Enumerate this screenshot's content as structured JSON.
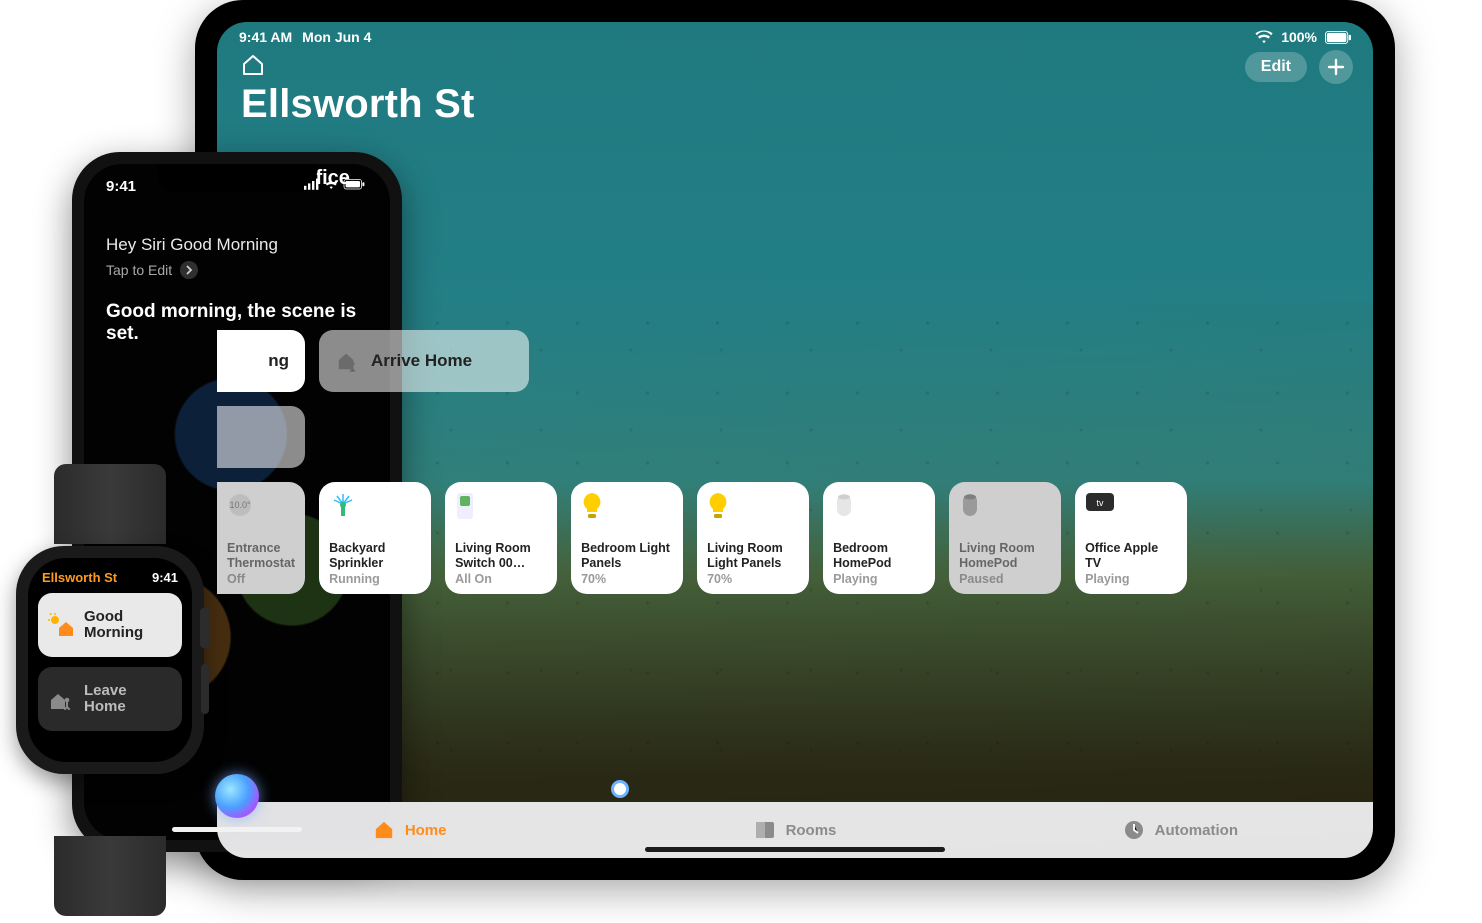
{
  "ipad": {
    "status": {
      "time": "9:41 AM",
      "date": "Mon Jun 4",
      "battery": "100%"
    },
    "edit_label": "Edit",
    "home_name": "Ellsworth St",
    "summary_suffix": "ed in Office.",
    "scenes": {
      "partial_visible": "ng",
      "arrive_home": "Arrive Home"
    },
    "tiles": [
      {
        "name": "Entrance Thermostat",
        "status": "Off",
        "kind": "thermostat",
        "dim": true,
        "cut": true
      },
      {
        "name": "Backyard Sprinkler",
        "status": "Running",
        "kind": "sprinkler",
        "dim": false
      },
      {
        "name": "Living Room Switch 00…",
        "status": "All On",
        "kind": "switch",
        "dim": false
      },
      {
        "name": "Bedroom Light Panels",
        "status": "70%",
        "kind": "bulb",
        "dim": false
      },
      {
        "name": "Living Room Light Panels",
        "status": "70%",
        "kind": "bulb",
        "dim": false
      },
      {
        "name": "Bedroom HomePod",
        "status": "Playing",
        "kind": "homepod",
        "dim": false
      },
      {
        "name": "Living Room HomePod",
        "status": "Paused",
        "kind": "homepod",
        "dim": true
      },
      {
        "name": "Office Apple TV",
        "status": "Playing",
        "kind": "appletv",
        "dim": false
      }
    ],
    "tabs": {
      "home": "Home",
      "rooms": "Rooms",
      "automation": "Automation"
    }
  },
  "iphone": {
    "status_time": "9:41",
    "siri_prompt": "Hey Siri Good Morning",
    "tap_to_edit": "Tap to Edit",
    "siri_response": "Good morning, the scene is set."
  },
  "watch": {
    "title": "Ellsworth St",
    "time": "9:41",
    "scenes": [
      {
        "label": "Good Morning",
        "light": true,
        "icon": "sun-house"
      },
      {
        "label": "Leave Home",
        "light": false,
        "icon": "person-house"
      }
    ]
  }
}
